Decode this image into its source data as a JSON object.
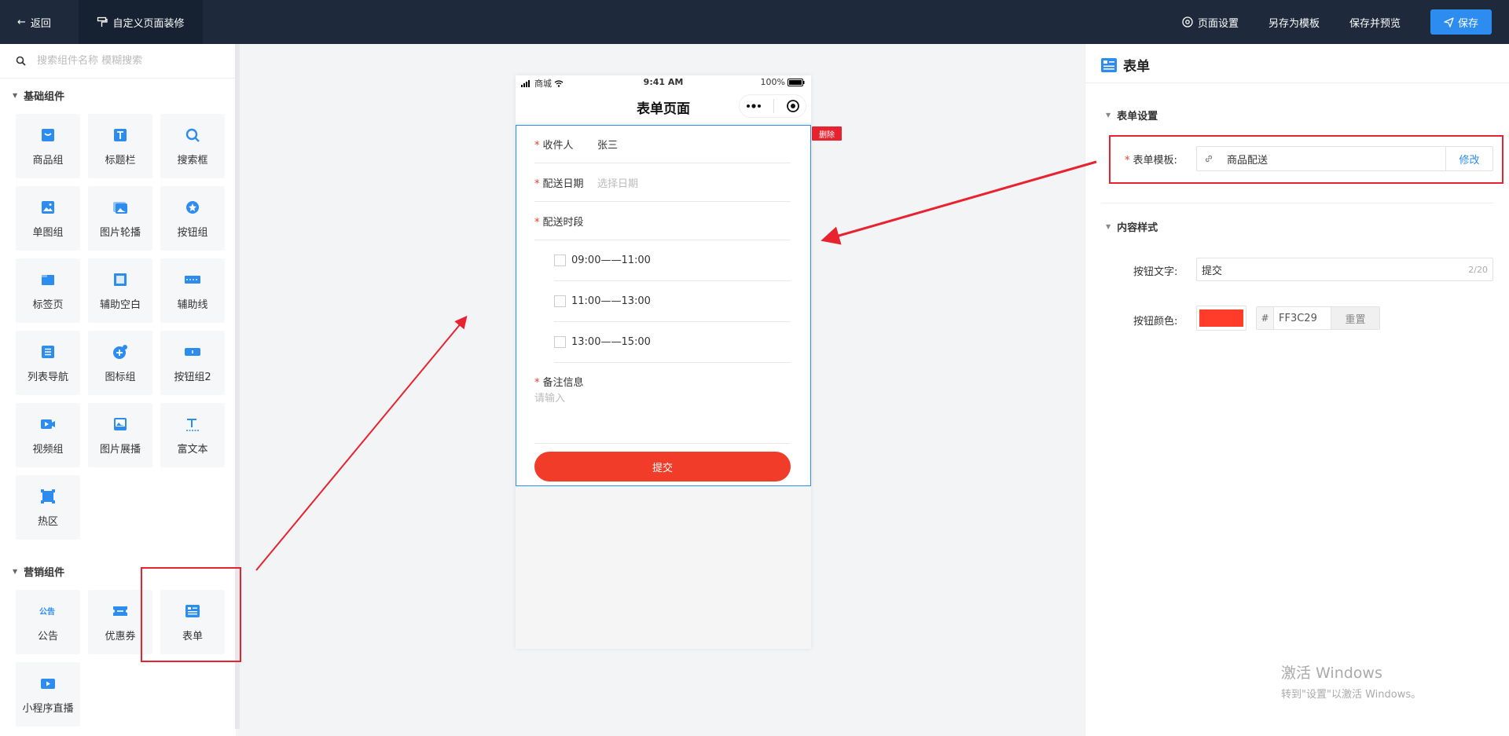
{
  "topbar": {
    "back_label": "返回",
    "decorate_label": "自定义页面装修",
    "page_settings_label": "页面设置",
    "save_template_label": "另存为模板",
    "save_preview_label": "保存并预览",
    "save_label": "保存"
  },
  "left": {
    "search_placeholder": "搜索组件名称 模糊搜索",
    "basic_title": "基础组件",
    "basic_items": [
      {
        "label": "商品组",
        "icon": "goods-icon"
      },
      {
        "label": "标题栏",
        "icon": "title-icon"
      },
      {
        "label": "搜索框",
        "icon": "search-icon"
      },
      {
        "label": "单图组",
        "icon": "image-icon"
      },
      {
        "label": "图片轮播",
        "icon": "carousel-icon"
      },
      {
        "label": "按钮组",
        "icon": "button-group-icon"
      },
      {
        "label": "标签页",
        "icon": "tabs-icon"
      },
      {
        "label": "辅助空白",
        "icon": "blank-icon"
      },
      {
        "label": "辅助线",
        "icon": "divider-icon"
      },
      {
        "label": "列表导航",
        "icon": "list-nav-icon"
      },
      {
        "label": "图标组",
        "icon": "icon-group-icon"
      },
      {
        "label": "按钮组2",
        "icon": "button-group2-icon"
      },
      {
        "label": "视频组",
        "icon": "video-icon"
      },
      {
        "label": "图片展播",
        "icon": "gallery-icon"
      },
      {
        "label": "富文本",
        "icon": "rich-text-icon"
      },
      {
        "label": "热区",
        "icon": "hotspot-icon"
      }
    ],
    "marketing_title": "营销组件",
    "marketing_items": [
      {
        "label": "公告",
        "icon": "notice-icon"
      },
      {
        "label": "优惠券",
        "icon": "coupon-icon"
      },
      {
        "label": "表单",
        "icon": "form-icon"
      },
      {
        "label": "小程序直播",
        "icon": "live-icon"
      }
    ]
  },
  "phone": {
    "carrier": "商城",
    "time": "9:41 AM",
    "battery": "100%",
    "page_title": "表单页面",
    "delete_tag": "删除",
    "fields": {
      "receiver_label": "收件人",
      "receiver_value": "张三",
      "date_label": "配送日期",
      "date_placeholder": "选择日期",
      "slot_label": "配送时段",
      "slots": [
        "09:00——11:00",
        "11:00——13:00",
        "13:00——15:00"
      ],
      "remark_label": "备注信息",
      "remark_placeholder": "请输入"
    },
    "submit_label": "提交"
  },
  "right": {
    "title": "表单",
    "section_form_settings": "表单设置",
    "template_label": "表单模板:",
    "template_value": "商品配送",
    "template_edit": "修改",
    "section_content_style": "内容样式",
    "button_text_label": "按钮文字:",
    "button_text_value": "提交",
    "button_text_count": "2/20",
    "button_color_label": "按钮颜色:",
    "button_color_hash": "#",
    "button_color_value": "FF3C29",
    "button_color_reset": "重置"
  },
  "watermark": {
    "line1": "激活 Windows",
    "line2": "转到\"设置\"以激活 Windows。"
  },
  "colors": {
    "accent": "#2d8cf0",
    "submit": "#f03c29",
    "annotation": "#e8232f"
  }
}
